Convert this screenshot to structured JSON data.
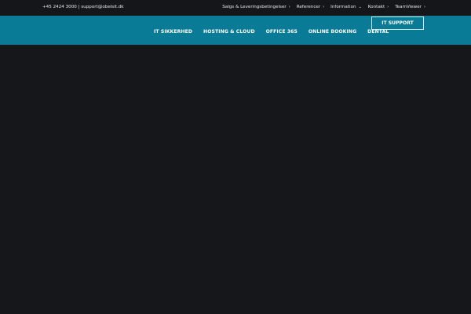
{
  "topbar": {
    "contact": "+45 2424 3000 | support@obelsit.dk",
    "links": [
      {
        "label": "Salgs & Leveringsbetingelser",
        "icon": "chevron-right-icon"
      },
      {
        "label": "Referencer",
        "icon": "chevron-right-icon"
      },
      {
        "label": "Information",
        "icon": "chevron-down-icon"
      },
      {
        "label": "Kontakt",
        "icon": "chevron-right-icon"
      },
      {
        "label": "TeamViewer",
        "icon": "chevron-right-icon"
      }
    ]
  },
  "header": {
    "background_color": "#0a7b97",
    "nav": [
      {
        "label": "IT SIKKERHED"
      },
      {
        "label": "HOSTING & CLOUD"
      },
      {
        "label": "OFFICE 365"
      },
      {
        "label": "ONLINE BOOKING"
      },
      {
        "label": "DENTAL"
      }
    ],
    "support_button": "IT SUPPORT"
  },
  "colors": {
    "page_background": "#141619",
    "header_background": "#0a7b97",
    "text": "#ffffff"
  }
}
